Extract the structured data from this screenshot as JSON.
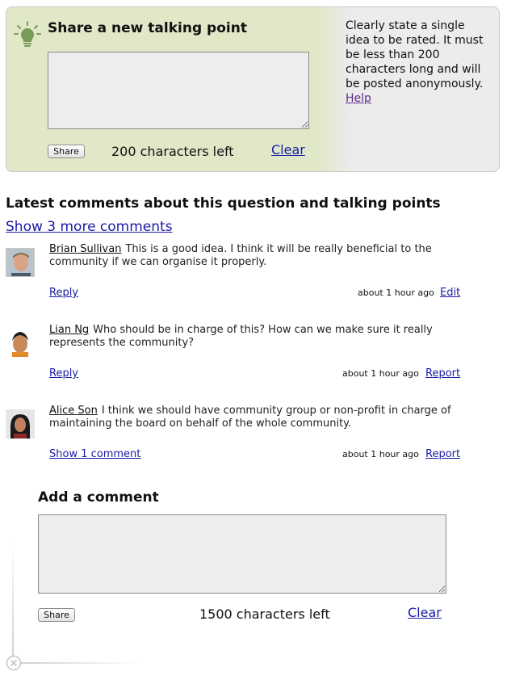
{
  "share_box": {
    "title": "Share a new talking point",
    "share_label": "Share",
    "chars_left": "200 characters left",
    "clear_label": "Clear",
    "hint_text": "Clearly state a single idea to be rated. It must be less than 200 characters long and will be posted anonymously.",
    "help_label": "Help",
    "icon": "lightbulb-icon"
  },
  "comments_section": {
    "title": "Latest comments about this question and talking points",
    "show_more": "Show 3 more comments"
  },
  "comments": [
    {
      "author": "Brian Sullivan",
      "text": "This is a good idea. I think it will be really beneficial to the community if we can organise it properly.",
      "action_left": "Reply",
      "time": "about 1 hour ago",
      "action_right": "Edit"
    },
    {
      "author": "Lian Ng",
      "text": "Who should be in charge of this? How can we make sure it really represents the community?",
      "action_left": "Reply",
      "time": "about 1 hour ago",
      "action_right": "Report"
    },
    {
      "author": "Alice Son",
      "text": "I think we should have community group or non-profit in charge of maintaining the board on behalf of the whole community.",
      "action_left": "Show 1 comment",
      "time": "about 1 hour ago",
      "action_right": "Report"
    }
  ],
  "add_comment": {
    "title": "Add a comment",
    "share_label": "Share",
    "chars_left": "1500 characters left",
    "clear_label": "Clear"
  },
  "colors": {
    "share_box_green": "#e0e8c8",
    "share_box_grey": "#ececec",
    "link_blue": "#1a1aa6",
    "textarea_bg": "#ededed"
  }
}
